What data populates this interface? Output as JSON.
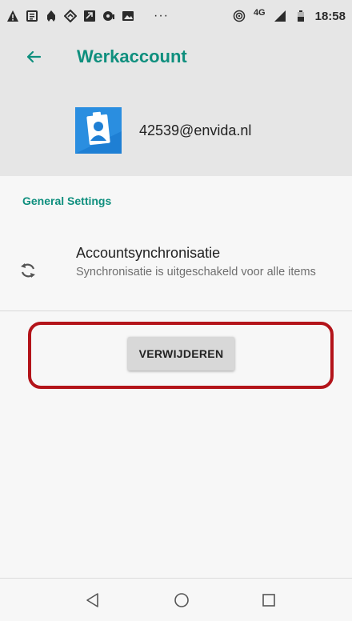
{
  "status_bar": {
    "more": "···",
    "network": "4G",
    "time": "18:58",
    "icons": [
      "warning-icon",
      "note-icon",
      "android-icon",
      "diamond-icon",
      "missed-call-icon",
      "chat-icon",
      "image-icon",
      "hotspot-icon",
      "signal-icon",
      "battery-icon"
    ]
  },
  "header": {
    "title": "Werkaccount",
    "back_icon": "arrow-back-icon",
    "account_email": "42539@envida.nl",
    "accent": "#0f8f7e"
  },
  "settings": {
    "section_title": "General Settings",
    "sync": {
      "title": "Accountsynchronisatie",
      "subtitle": "Synchronisatie is uitgeschakeld voor alle items",
      "icon": "sync-icon"
    }
  },
  "actions": {
    "remove_label": "VERWIJDEREN",
    "highlight_color": "#b3141a"
  },
  "nav": {
    "icons": [
      "nav-back-icon",
      "nav-home-icon",
      "nav-recent-icon"
    ]
  }
}
